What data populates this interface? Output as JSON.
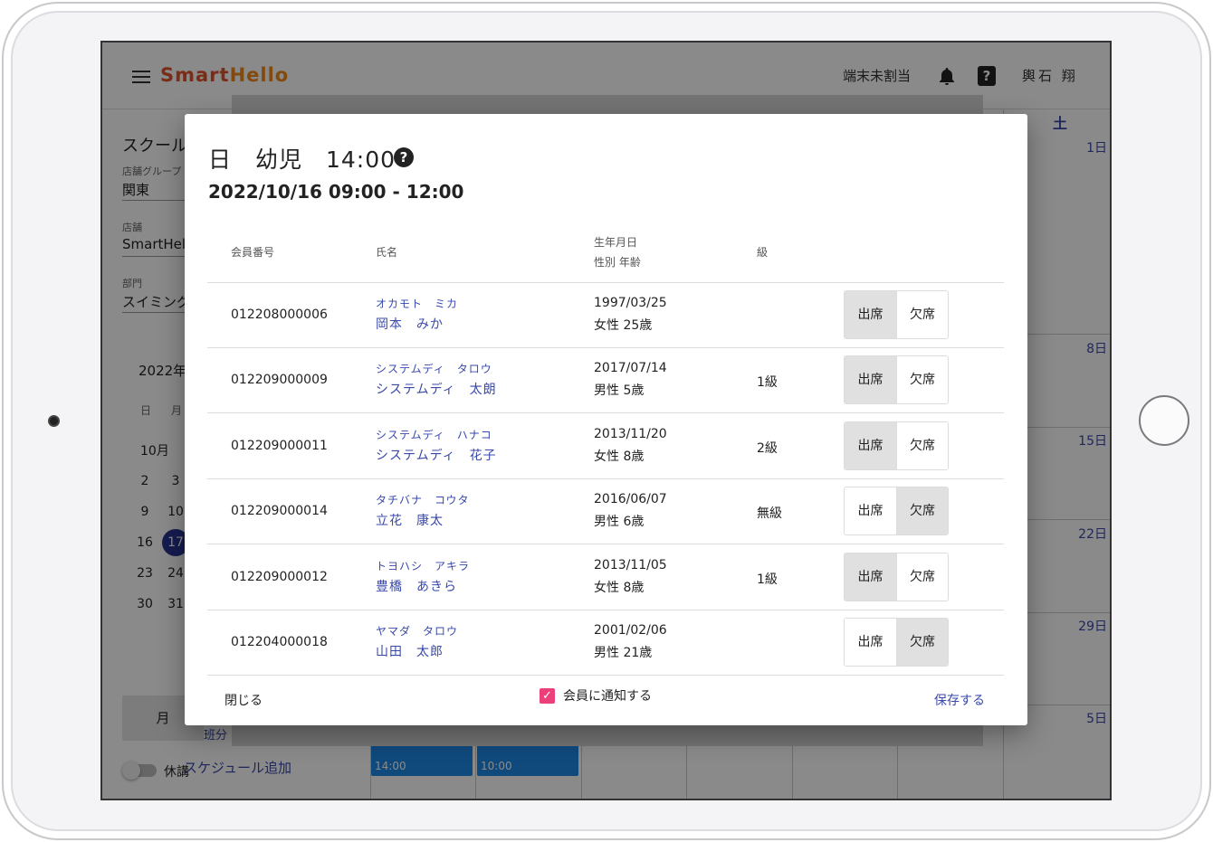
{
  "appbar": {
    "brand_part1": "Smart",
    "brand_part2": "Hello",
    "terminal_status": "端末未割当",
    "user_name": "輿石 翔"
  },
  "sidebar": {
    "title": "スクール",
    "store_group_label": "店舗グループ",
    "store_group_value": "関東",
    "store_label": "店舗",
    "store_value": "SmartHello",
    "department_label": "部門",
    "department_value": "スイミング",
    "calendar_month": "2022年",
    "weekdays": [
      "日",
      "月"
    ],
    "month_label": "10月",
    "days": [
      "2",
      "3",
      "9",
      "10",
      "16",
      "17",
      "23",
      "24",
      "30",
      "31"
    ],
    "view_button": "月",
    "holiday_toggle_label": "休講",
    "partial_text": "班分",
    "add_schedule": "スケジュール追加"
  },
  "calendar": {
    "saturday_header": "土",
    "days": [
      "1日",
      "8日",
      "15日",
      "22日",
      "29日",
      "5日"
    ],
    "events": [
      "14:00",
      "10:00"
    ]
  },
  "dialog": {
    "title": "日　幼児　14:00",
    "subtitle": "2022/10/16 09:00 - 12:00",
    "headers": {
      "member_id": "会員番号",
      "name": "氏名",
      "birth": "生年月日",
      "gender_age": "性別 年齢",
      "grade": "級"
    },
    "attend_label": "出席",
    "absent_label": "欠席",
    "rows": [
      {
        "id": "012208000006",
        "kana": "オカモト　ミカ",
        "name": "岡本　みか",
        "birth": "1997/03/25",
        "gender_age": "女性 25歳",
        "grade": "",
        "status": "attend"
      },
      {
        "id": "012209000009",
        "kana": "システムディ　タロウ",
        "name": "システムディ　太朗",
        "birth": "2017/07/14",
        "gender_age": "男性 5歳",
        "grade": "1級",
        "status": "attend"
      },
      {
        "id": "012209000011",
        "kana": "システムディ　ハナコ",
        "name": "システムディ　花子",
        "birth": "2013/11/20",
        "gender_age": "女性 8歳",
        "grade": "2級",
        "status": "attend"
      },
      {
        "id": "012209000014",
        "kana": "タチバナ　コウタ",
        "name": "立花　康太",
        "birth": "2016/06/07",
        "gender_age": "男性 6歳",
        "grade": "無級",
        "status": "absent"
      },
      {
        "id": "012209000012",
        "kana": "トヨハシ　アキラ",
        "name": "豊橋　あきら",
        "birth": "2013/11/05",
        "gender_age": "女性 8歳",
        "grade": "1級",
        "status": "attend"
      },
      {
        "id": "012204000018",
        "kana": "ヤマダ　タロウ",
        "name": "山田　太郎",
        "birth": "2001/02/06",
        "gender_age": "男性 21歳",
        "grade": "",
        "status": "absent"
      }
    ],
    "close_label": "閉じる",
    "notify_label": "会員に通知する",
    "notify_checked": true,
    "save_label": "保存する"
  }
}
